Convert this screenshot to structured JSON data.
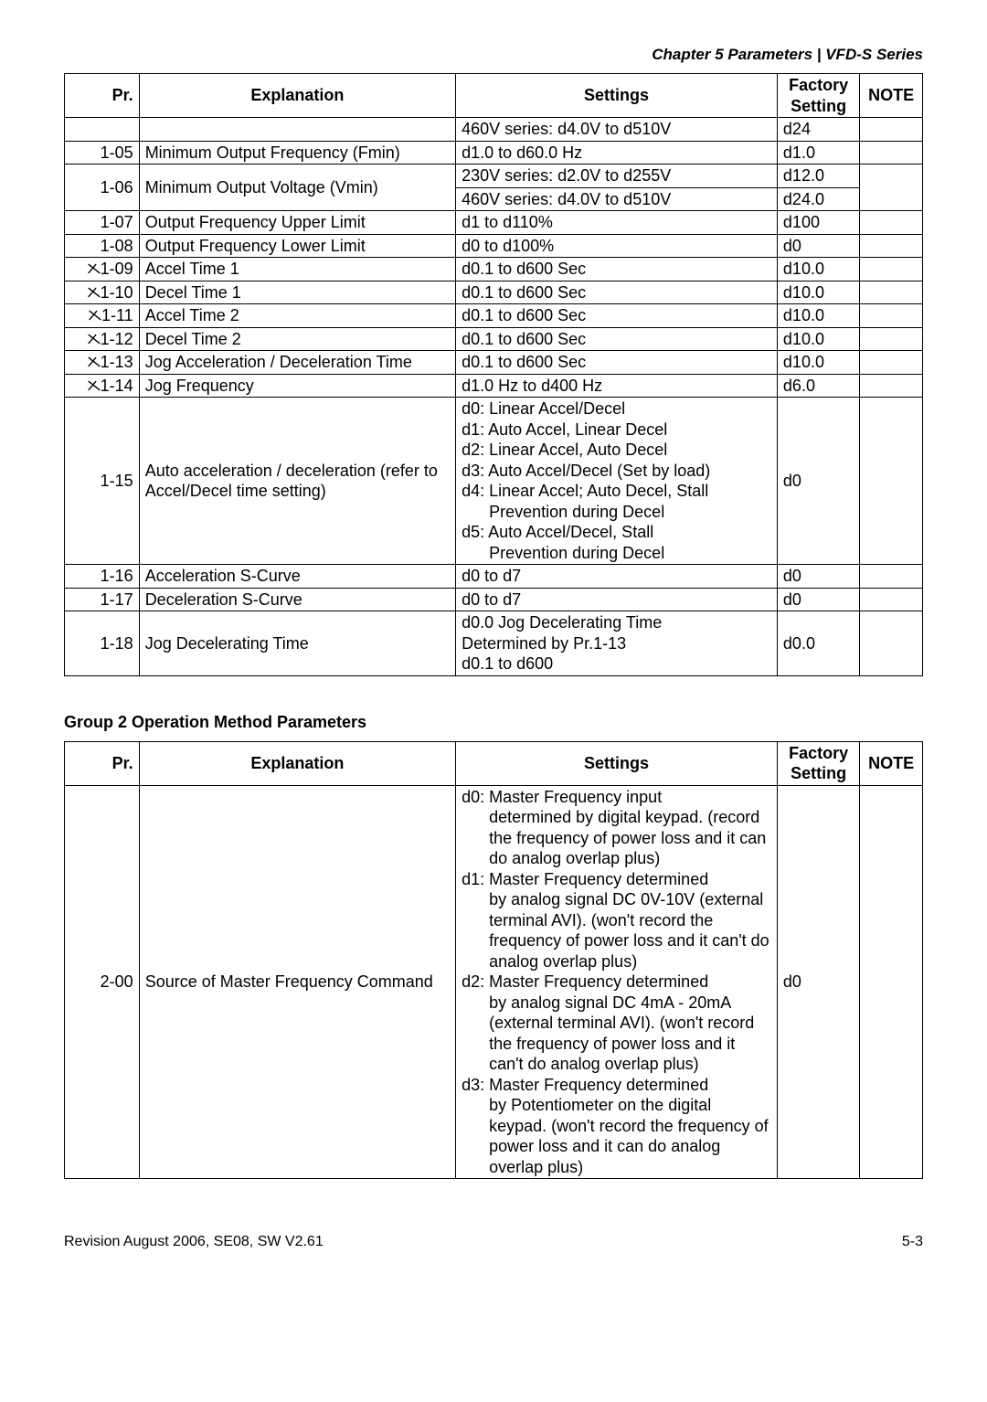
{
  "chapter_header": "Chapter 5 Parameters | VFD-S Series",
  "t1_headers": {
    "pr": "Pr.",
    "expl": "Explanation",
    "set": "Settings",
    "fac1": "Factory",
    "fac2": "Setting",
    "note": "NOTE"
  },
  "t1_rows": [
    {
      "pr": "",
      "check": false,
      "expl": "",
      "set": "460V series: d4.0V to d510V",
      "fac": "d24",
      "note": ""
    },
    {
      "pr": "1-05",
      "check": false,
      "expl": "Minimum Output Frequency (Fmin)",
      "set": "d1.0 to d60.0 Hz",
      "fac": "d1.0",
      "note": ""
    },
    {
      "pr": "1-06",
      "check": false,
      "expl": "Minimum Output Voltage (Vmin)",
      "set": "230V series: d2.0V to d255V",
      "fac": "d12.0",
      "note": "",
      "rowspan_pr": 2,
      "rowspan_expl": 2,
      "rowspan_note": 2
    },
    {
      "pr": null,
      "check": false,
      "expl": null,
      "set": "460V series: d4.0V to d510V",
      "fac": "d24.0",
      "note": null
    },
    {
      "pr": "1-07",
      "check": false,
      "expl": "Output Frequency Upper Limit",
      "set": "d1 to d110%",
      "fac": "d100",
      "note": ""
    },
    {
      "pr": "1-08",
      "check": false,
      "expl": "Output Frequency Lower Limit",
      "set": "d0 to d100%",
      "fac": "d0",
      "note": ""
    },
    {
      "pr": "1-09",
      "check": true,
      "expl": "Accel Time 1",
      "set": "d0.1 to d600 Sec",
      "fac": "d10.0",
      "note": ""
    },
    {
      "pr": "1-10",
      "check": true,
      "expl": "Decel Time 1",
      "set": "d0.1 to d600 Sec",
      "fac": "d10.0",
      "note": ""
    },
    {
      "pr": "1-11",
      "check": true,
      "expl": "Accel Time 2",
      "set": "d0.1 to d600 Sec",
      "fac": "d10.0",
      "note": ""
    },
    {
      "pr": "1-12",
      "check": true,
      "expl": "Decel Time 2",
      "set": "d0.1 to d600 Sec",
      "fac": "d10.0",
      "note": ""
    },
    {
      "pr": "1-13",
      "check": true,
      "expl": "Jog Acceleration / Deceleration Time",
      "set": "d0.1 to d600 Sec",
      "fac": "d10.0",
      "note": ""
    },
    {
      "pr": "1-14",
      "check": true,
      "expl": "Jog Frequency",
      "set": "d1.0 Hz to d400 Hz",
      "fac": "d6.0",
      "note": ""
    },
    {
      "pr": "1-15",
      "check": false,
      "expl": "Auto acceleration / deceleration (refer to Accel/Decel time setting)",
      "set_lines": [
        "d0: Linear Accel/Decel",
        "d1: Auto Accel, Linear Decel",
        "d2: Linear Accel, Auto Decel",
        "d3: Auto Accel/Decel (Set by load)",
        "d4: Linear Accel; Auto Decel, Stall",
        "      Prevention during Decel",
        "d5: Auto Accel/Decel, Stall",
        "      Prevention during Decel"
      ],
      "fac": "d0",
      "note": ""
    },
    {
      "pr": "1-16",
      "check": false,
      "expl": "Acceleration S-Curve",
      "set": "d0 to d7",
      "fac": "d0",
      "note": ""
    },
    {
      "pr": "1-17",
      "check": false,
      "expl": "Deceleration S-Curve",
      "set": "d0 to d7",
      "fac": "d0",
      "note": ""
    },
    {
      "pr": "1-18",
      "check": false,
      "expl": "Jog Decelerating Time",
      "set_lines": [
        "d0.0 Jog Decelerating Time",
        "Determined by Pr.1-13",
        "d0.1 to d600"
      ],
      "fac": "d0.0",
      "note": ""
    }
  ],
  "group2_title": "Group 2 Operation Method Parameters",
  "t2_headers": {
    "pr": "Pr.",
    "expl": "Explanation",
    "set": "Settings",
    "fac1": "Factory",
    "fac2": "Setting",
    "note": "NOTE"
  },
  "t2_row": {
    "pr": "2-00",
    "expl": "Source of Master Frequency Command",
    "set_items": [
      {
        "head": "d0: Master Frequency input",
        "body": "determined by digital keypad. (record the frequency of power loss and it can do analog overlap plus)"
      },
      {
        "head": "d1: Master Frequency determined",
        "body": "by analog signal DC 0V-10V (external terminal AVI). (won't record the frequency of power loss and it can't do analog overlap plus)"
      },
      {
        "head": "d2: Master Frequency determined",
        "body": "by analog signal DC 4mA - 20mA (external terminal AVI). (won't record the frequency of power loss and it can't do analog overlap plus)"
      },
      {
        "head": "d3: Master Frequency determined",
        "body": "by Potentiometer on the digital keypad. (won't record the frequency of power loss and it can do analog overlap plus)"
      }
    ],
    "fac": "d0",
    "note": ""
  },
  "footer_left": "Revision August 2006, SE08, SW V2.61",
  "footer_right": "5-3"
}
